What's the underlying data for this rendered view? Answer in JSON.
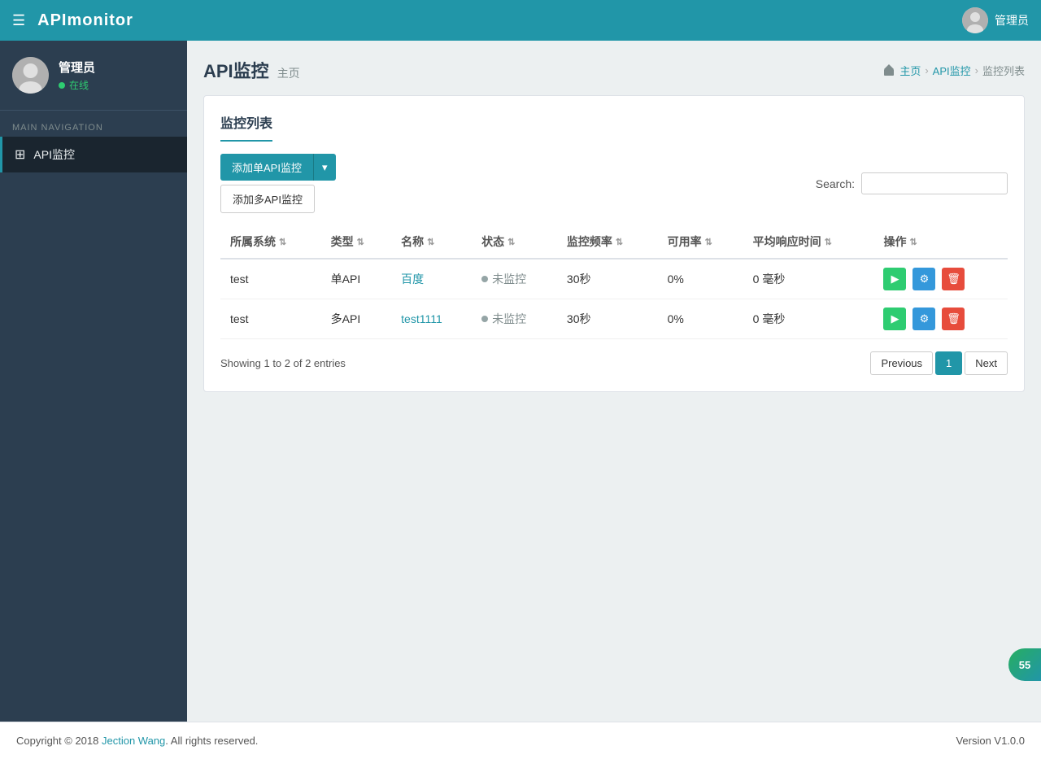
{
  "app": {
    "brand": "APImonitor",
    "hamburger_icon": "☰"
  },
  "topbar": {
    "user_label": "管理员",
    "user_icon": "person-icon"
  },
  "sidebar": {
    "username": "管理员",
    "status": "在线",
    "nav_label": "MAIN NAVIGATION",
    "items": [
      {
        "id": "api-monitor",
        "label": "API监控",
        "icon": "⊞",
        "active": true
      }
    ]
  },
  "page": {
    "title": "API监控",
    "subtitle": "主页",
    "breadcrumb": [
      {
        "label": "主页",
        "link": true
      },
      {
        "label": "API监控",
        "link": true
      },
      {
        "label": "监控列表",
        "link": false
      }
    ],
    "breadcrumb_sep": "›"
  },
  "card": {
    "title": "监控列表",
    "add_single_label": "添加单API监控",
    "add_multi_label": "添加多API监控",
    "dropdown_caret": "▾",
    "search_label": "Search:",
    "search_placeholder": ""
  },
  "table": {
    "columns": [
      {
        "key": "system",
        "label": "所属系统"
      },
      {
        "key": "type",
        "label": "类型"
      },
      {
        "key": "name",
        "label": "名称"
      },
      {
        "key": "status",
        "label": "状态"
      },
      {
        "key": "frequency",
        "label": "监控频率"
      },
      {
        "key": "availability",
        "label": "可用率"
      },
      {
        "key": "avg_response",
        "label": "平均响应时间"
      },
      {
        "key": "actions",
        "label": "操作"
      }
    ],
    "rows": [
      {
        "system": "test",
        "type": "单API",
        "name": "百度",
        "name_is_link": true,
        "status": "未监控",
        "frequency": "30秒",
        "availability": "0%",
        "avg_response": "0 毫秒"
      },
      {
        "system": "test",
        "type": "多API",
        "name": "test1111",
        "name_is_link": true,
        "status": "未监控",
        "frequency": "30秒",
        "availability": "0%",
        "avg_response": "0 毫秒"
      }
    ],
    "info": "Showing 1 to 2 of 2 entries"
  },
  "pagination": {
    "previous_label": "Previous",
    "next_label": "Next",
    "pages": [
      1
    ],
    "active_page": 1
  },
  "footer": {
    "copyright": "Copyright © 2018 ",
    "author": "Jection Wang",
    "rights": ". All rights reserved.",
    "version": "Version V1.0.0"
  },
  "floating_badge": {
    "text": "55"
  }
}
